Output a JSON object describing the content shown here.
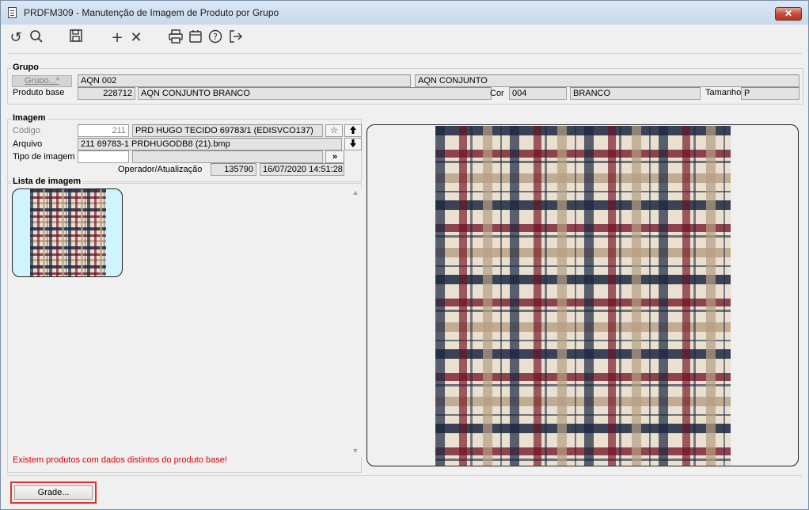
{
  "window": {
    "title": "PRDFM309 - Manutenção de Imagem de Produto por Grupo",
    "close_label": "✕"
  },
  "toolbar": {
    "icons": [
      "undo-icon",
      "search-icon",
      "save-icon",
      "add-icon",
      "delete-icon",
      "print-icon",
      "calendar-icon",
      "help-icon",
      "exit-icon"
    ]
  },
  "grupo": {
    "section_title": "Grupo",
    "grupo_button": "Grupo...*",
    "grupo_code": "AQN 002",
    "grupo_name": "AQN CONJUNTO",
    "produto_base_label": "Produto base",
    "produto_base_code": "228712",
    "produto_base_name": "AQN CONJUNTO BRANCO",
    "cor_label": "Cor",
    "cor_code": "004",
    "cor_name": "BRANCO",
    "tamanho_label": "Tamanho",
    "tamanho_value": "P"
  },
  "imagem": {
    "section_title": "Imagem",
    "codigo_label": "Código",
    "codigo_value": "211",
    "codigo_desc": "PRD HUGO TECIDO 69783/1 (EDISVCO137)",
    "star_button": "☆",
    "up_button": "🡅",
    "arquivo_label": "Arquivo",
    "arquivo_value": "211 69783-1 PRDHUGODB8 (21).bmp",
    "down_button": "🡇",
    "tipo_label": "Tipo de imagem",
    "tipo_value": "",
    "tipo_desc": "",
    "more_button": "»",
    "operador_label": "Operador/Atualização",
    "operador_value": "135790",
    "atualizacao_value": "16/07/2020 14:51:28"
  },
  "lista": {
    "section_title": "Lista de imagem",
    "warning": "Existem produtos com dados distintos do produto base!",
    "scroll_up": "▲",
    "scroll_down": "▼"
  },
  "footer": {
    "grade_button": "Grade..."
  },
  "colors": {
    "plaid_base": "#e9e0cf",
    "plaid_navy": "#1b2740",
    "plaid_red": "#6e0f22",
    "plaid_tan": "#b79f84",
    "warning": "#e00000",
    "highlight": "#e03030"
  }
}
